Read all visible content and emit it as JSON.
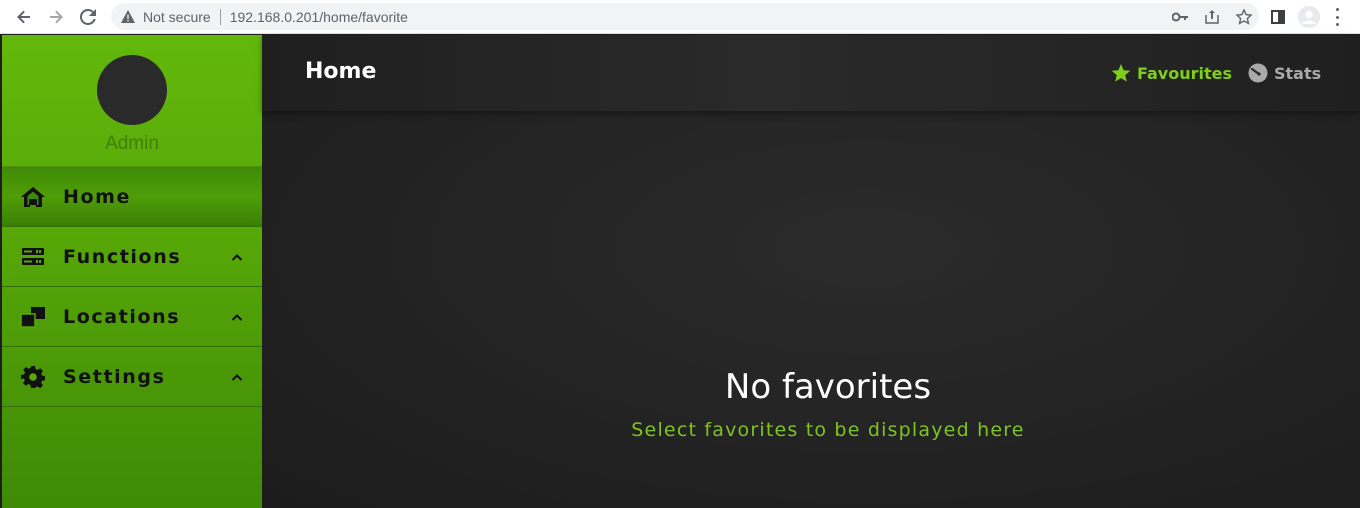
{
  "browser": {
    "security_label": "Not secure",
    "url": "192.168.0.201/home/favorite"
  },
  "sidebar": {
    "user_name": "Admin",
    "items": [
      {
        "label": "Home",
        "icon": "home-icon",
        "active": true
      },
      {
        "label": "Functions",
        "icon": "functions-icon",
        "expandable": true
      },
      {
        "label": "Locations",
        "icon": "locations-icon",
        "expandable": true
      },
      {
        "label": "Settings",
        "icon": "gear-icon",
        "expandable": true
      }
    ]
  },
  "header": {
    "title": "Home",
    "favourites_label": "Favourites",
    "stats_label": "Stats"
  },
  "empty_state": {
    "title": "No favorites",
    "subtitle": "Select favorites to be displayed here"
  },
  "colors": {
    "accent_green": "#7fce1b",
    "sidebar_green": "#58a808",
    "main_bg": "#222222"
  }
}
